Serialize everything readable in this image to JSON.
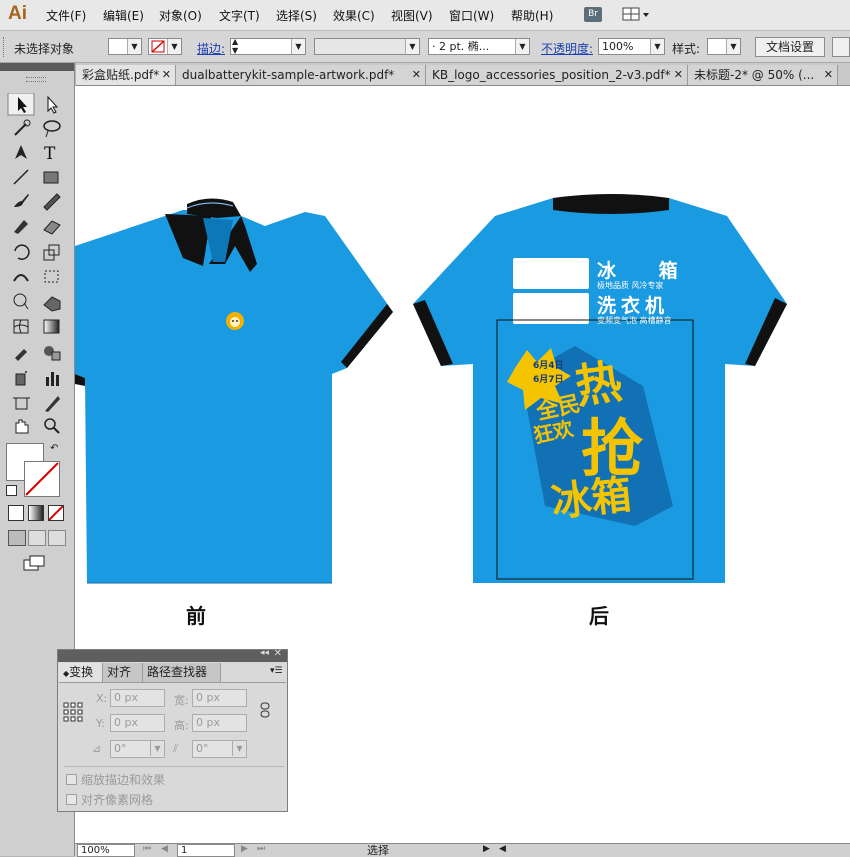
{
  "app": {
    "logo": "Ai"
  },
  "menu": [
    {
      "label": "文件(F)"
    },
    {
      "label": "编辑(E)"
    },
    {
      "label": "对象(O)"
    },
    {
      "label": "文字(T)"
    },
    {
      "label": "选择(S)"
    },
    {
      "label": "效果(C)"
    },
    {
      "label": "视图(V)"
    },
    {
      "label": "窗口(W)"
    },
    {
      "label": "帮助(H)"
    }
  ],
  "menu_right": {
    "bridge_label": "Br"
  },
  "control": {
    "selection_status": "未选择对象",
    "stroke_label": "描边:",
    "brush_value": "· 2 pt. 椭...",
    "opacity_label": "不透明度:",
    "opacity_value": "100%",
    "style_label": "样式:",
    "doc_setup_button": "文档设置"
  },
  "tabs": [
    {
      "label": "彩盒贴纸.pdf*"
    },
    {
      "label": "dualbatterykit-sample-artwork.pdf*"
    },
    {
      "label": "KB_logo_accessories_position_2-v3.pdf*"
    },
    {
      "label": "未标题-2* @ 50% (..."
    }
  ],
  "canvas": {
    "front_caption": "前",
    "back_caption": "后",
    "shirt_color": "#1a9ae0",
    "back_print": {
      "product1": "冰 箱",
      "product1_sub": "极地品质 风冷专家",
      "product2": "洗衣机",
      "product2_sub": "变频变气泡 高槽静音",
      "date1": "6月4日",
      "date2": "6月7日",
      "slogan_small1": "全民",
      "slogan_small2": "狂欢",
      "slogan_big1": "热",
      "slogan_big2": "抢",
      "slogan_big3": "冰箱"
    }
  },
  "transform_panel": {
    "tabs": [
      {
        "label": "变换"
      },
      {
        "label": "对齐"
      },
      {
        "label": "路径查找器"
      }
    ],
    "x_label": "X:",
    "x_value": "0 px",
    "w_label": "宽:",
    "w_value": "0 px",
    "y_label": "Y:",
    "y_value": "0 px",
    "h_label": "高:",
    "h_value": "0 px",
    "rotate_value": "0°",
    "shear_value": "0°",
    "scale_strokes_label": "缩放描边和效果",
    "align_pixel_label": "对齐像素网格"
  },
  "status": {
    "zoom_value": "100%",
    "page_value": "1",
    "tool_name": "选择"
  }
}
